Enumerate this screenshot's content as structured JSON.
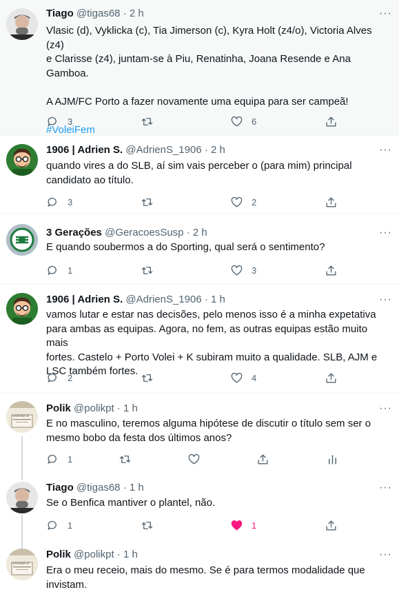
{
  "tweets": [
    {
      "name": "Tiago",
      "handle": "@tigas68",
      "time": "2 h",
      "lines": [
        "Vlasic (d), Vyklicka (c), Tia Jimerson (c), Kyra Holt (z4/o), Victoria Alves (z4)",
        "e Clarisse (z4), juntam-se à Piu, Renatinha, Joana Resende e Ana Gamboa.",
        "",
        "A AJM/FC Porto a fazer novamente uma equipa para ser campeã!",
        ""
      ],
      "hashtag": "#VoleiFem",
      "replies": "3",
      "retweets": "",
      "likes": "6"
    },
    {
      "name": "1906 | Adrien S.",
      "handle": "@AdrienS_1906",
      "time": "2 h",
      "lines": [
        "quando vires a do SLB, aí sim vais perceber o (para mim) principal",
        "candidato ao título."
      ],
      "replies": "3",
      "retweets": "",
      "likes": "2"
    },
    {
      "name": "3 Gerações",
      "handle": "@GeracoesSusp",
      "time": "2 h",
      "lines": [
        "E quando soubermos a do Sporting, qual será o sentimento?"
      ],
      "replies": "1",
      "retweets": "",
      "likes": "3"
    },
    {
      "name": "1906 | Adrien S.",
      "handle": "@AdrienS_1906",
      "time": "1 h",
      "lines": [
        "vamos lutar e estar nas decisões, pelo menos isso é a minha expetativa",
        "para ambas as equipas. Agora, no fem, as outras equipas estão muito mais",
        "fortes. Castelo + Porto Volei + K subiram muito a qualidade. SLB, AJM e",
        "LSC também fortes."
      ],
      "replies": "2",
      "retweets": "",
      "likes": "4"
    },
    {
      "name": "Polik",
      "handle": "@polikpt",
      "time": "1 h",
      "lines": [
        "E no masculino, teremos alguma hipótese de discutir o título sem ser o",
        "mesmo bobo da festa dos últimos anos?"
      ],
      "replies": "1",
      "retweets": "",
      "likes": ""
    },
    {
      "name": "Tiago",
      "handle": "@tigas68",
      "time": "1 h",
      "lines": [
        "Se o Benfica mantiver o plantel, não."
      ],
      "replies": "1",
      "retweets": "",
      "likes": "1"
    },
    {
      "name": "Polik",
      "handle": "@polikpt",
      "time": "1 h",
      "lines": [
        "Era o meu receio, mais do mesmo. Se é para termos modalidade que",
        "invistam."
      ]
    }
  ],
  "separator": "·",
  "more_glyph": "···",
  "avatar_label": "SAPARIGA",
  "colors": {
    "text": "#0f1419",
    "muted": "#536471",
    "link": "#1d9bf0",
    "like_active": "#f91880",
    "highlight_bg": "#f7f9f9"
  }
}
